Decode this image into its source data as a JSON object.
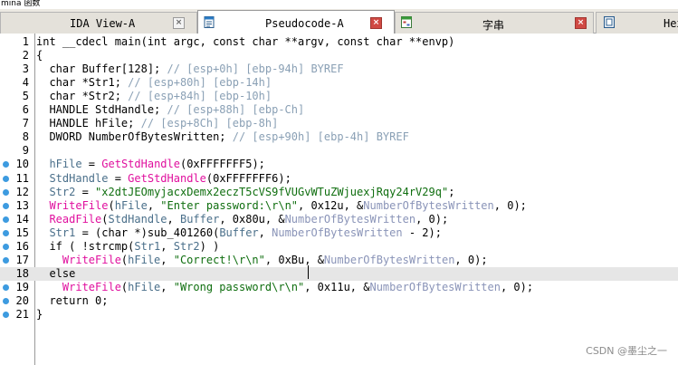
{
  "window": {
    "title_fragment": "mina 函数"
  },
  "tabs": [
    {
      "label": "IDA View-A",
      "icon": "ida-view-icon",
      "active": false
    },
    {
      "label": "Pseudocode-A",
      "icon": "pseudocode-icon",
      "active": true
    },
    {
      "label": "字串",
      "icon": "strings-icon",
      "active": false
    },
    {
      "label": "Hex",
      "icon": "hex-view-icon",
      "active": false
    }
  ],
  "colors": {
    "keyword_text": "#000000",
    "comment": "#8aa0b5",
    "function": "#e0109e",
    "variable": "#4a6f8a",
    "string": "#0f6e0f",
    "breakpoint_dot": "#3d9be0",
    "close_button": "#d04a44"
  },
  "code_lines": [
    {
      "n": "1",
      "dot": false,
      "segs": [
        {
          "t": "int __cdecl main(int argc, const char **argv, const char **envp)",
          "c": ""
        }
      ]
    },
    {
      "n": "2",
      "dot": false,
      "segs": [
        {
          "t": "{",
          "c": ""
        }
      ]
    },
    {
      "n": "3",
      "dot": false,
      "segs": [
        {
          "t": "  char Buffer[128]; ",
          "c": ""
        },
        {
          "t": "// [esp+0h] [ebp-94h] BYREF",
          "c": "cm"
        }
      ]
    },
    {
      "n": "4",
      "dot": false,
      "segs": [
        {
          "t": "  char *Str1; ",
          "c": ""
        },
        {
          "t": "// [esp+80h] [ebp-14h]",
          "c": "cm"
        }
      ]
    },
    {
      "n": "5",
      "dot": false,
      "segs": [
        {
          "t": "  char *Str2; ",
          "c": ""
        },
        {
          "t": "// [esp+84h] [ebp-10h]",
          "c": "cm"
        }
      ]
    },
    {
      "n": "6",
      "dot": false,
      "segs": [
        {
          "t": "  HANDLE StdHandle; ",
          "c": ""
        },
        {
          "t": "// [esp+88h] [ebp-Ch]",
          "c": "cm"
        }
      ]
    },
    {
      "n": "7",
      "dot": false,
      "segs": [
        {
          "t": "  HANDLE hFile; ",
          "c": ""
        },
        {
          "t": "// [esp+8Ch] [ebp-8h]",
          "c": "cm"
        }
      ]
    },
    {
      "n": "8",
      "dot": false,
      "segs": [
        {
          "t": "  DWORD NumberOfBytesWritten; ",
          "c": ""
        },
        {
          "t": "// [esp+90h] [ebp-4h] BYREF",
          "c": "cm"
        }
      ]
    },
    {
      "n": "9",
      "dot": false,
      "segs": [
        {
          "t": "",
          "c": ""
        }
      ]
    },
    {
      "n": "10",
      "dot": true,
      "segs": [
        {
          "t": "  hFile",
          "c": "var"
        },
        {
          "t": " = ",
          "c": ""
        },
        {
          "t": "GetStdHandle",
          "c": "fn"
        },
        {
          "t": "(0xFFFFFFF5);",
          "c": ""
        }
      ]
    },
    {
      "n": "11",
      "dot": true,
      "segs": [
        {
          "t": "  StdHandle",
          "c": "var"
        },
        {
          "t": " = ",
          "c": ""
        },
        {
          "t": "GetStdHandle",
          "c": "fn"
        },
        {
          "t": "(0xFFFFFFF6);",
          "c": ""
        }
      ]
    },
    {
      "n": "12",
      "dot": true,
      "segs": [
        {
          "t": "  Str2",
          "c": "var"
        },
        {
          "t": " = ",
          "c": ""
        },
        {
          "t": "\"x2dtJEOmyjacxDemx2eczT5cVS9fVUGvWTuZWjuexjRqy24rV29q\"",
          "c": "str"
        },
        {
          "t": ";",
          "c": ""
        }
      ]
    },
    {
      "n": "13",
      "dot": true,
      "segs": [
        {
          "t": "  WriteFile",
          "c": "fn"
        },
        {
          "t": "(",
          "c": ""
        },
        {
          "t": "hFile",
          "c": "var"
        },
        {
          "t": ", ",
          "c": ""
        },
        {
          "t": "\"Enter password:\\r\\n\"",
          "c": "str"
        },
        {
          "t": ", 0x12u, &",
          "c": ""
        },
        {
          "t": "NumberOfBytesWritten",
          "c": "gv"
        },
        {
          "t": ", 0);",
          "c": ""
        }
      ]
    },
    {
      "n": "14",
      "dot": true,
      "segs": [
        {
          "t": "  ReadFile",
          "c": "fn"
        },
        {
          "t": "(",
          "c": ""
        },
        {
          "t": "StdHandle",
          "c": "var"
        },
        {
          "t": ", ",
          "c": ""
        },
        {
          "t": "Buffer",
          "c": "var"
        },
        {
          "t": ", 0x80u, &",
          "c": ""
        },
        {
          "t": "NumberOfBytesWritten",
          "c": "gv"
        },
        {
          "t": ", 0);",
          "c": ""
        }
      ]
    },
    {
      "n": "15",
      "dot": true,
      "segs": [
        {
          "t": "  Str1",
          "c": "var"
        },
        {
          "t": " = (char *)sub_401260(",
          "c": ""
        },
        {
          "t": "Buffer",
          "c": "var"
        },
        {
          "t": ", ",
          "c": ""
        },
        {
          "t": "NumberOfBytesWritten",
          "c": "gv"
        },
        {
          "t": " - 2);",
          "c": ""
        }
      ]
    },
    {
      "n": "16",
      "dot": true,
      "segs": [
        {
          "t": "  if ( !strcmp(",
          "c": ""
        },
        {
          "t": "Str1",
          "c": "var"
        },
        {
          "t": ", ",
          "c": ""
        },
        {
          "t": "Str2",
          "c": "var"
        },
        {
          "t": ") )",
          "c": ""
        }
      ]
    },
    {
      "n": "17",
      "dot": true,
      "segs": [
        {
          "t": "    WriteFile",
          "c": "fn"
        },
        {
          "t": "(",
          "c": ""
        },
        {
          "t": "hFile",
          "c": "var"
        },
        {
          "t": ", ",
          "c": ""
        },
        {
          "t": "\"Correct!\\r\\n\"",
          "c": "str"
        },
        {
          "t": ", 0xBu, &",
          "c": ""
        },
        {
          "t": "NumberOfBytesWritten",
          "c": "gv"
        },
        {
          "t": ", 0);",
          "c": ""
        }
      ]
    },
    {
      "n": "18",
      "dot": false,
      "hl": true,
      "segs": [
        {
          "t": "  else",
          "c": ""
        }
      ]
    },
    {
      "n": "19",
      "dot": true,
      "segs": [
        {
          "t": "    WriteFile",
          "c": "fn"
        },
        {
          "t": "(",
          "c": ""
        },
        {
          "t": "hFile",
          "c": "var"
        },
        {
          "t": ", ",
          "c": ""
        },
        {
          "t": "\"Wrong password\\r\\n\"",
          "c": "str"
        },
        {
          "t": ", 0x11u, &",
          "c": ""
        },
        {
          "t": "NumberOfBytesWritten",
          "c": "gv"
        },
        {
          "t": ", 0);",
          "c": ""
        }
      ]
    },
    {
      "n": "20",
      "dot": true,
      "segs": [
        {
          "t": "  return 0;",
          "c": ""
        }
      ]
    },
    {
      "n": "21",
      "dot": true,
      "segs": [
        {
          "t": "}",
          "c": ""
        }
      ]
    }
  ],
  "watermark": "CSDN @墨尘之一"
}
